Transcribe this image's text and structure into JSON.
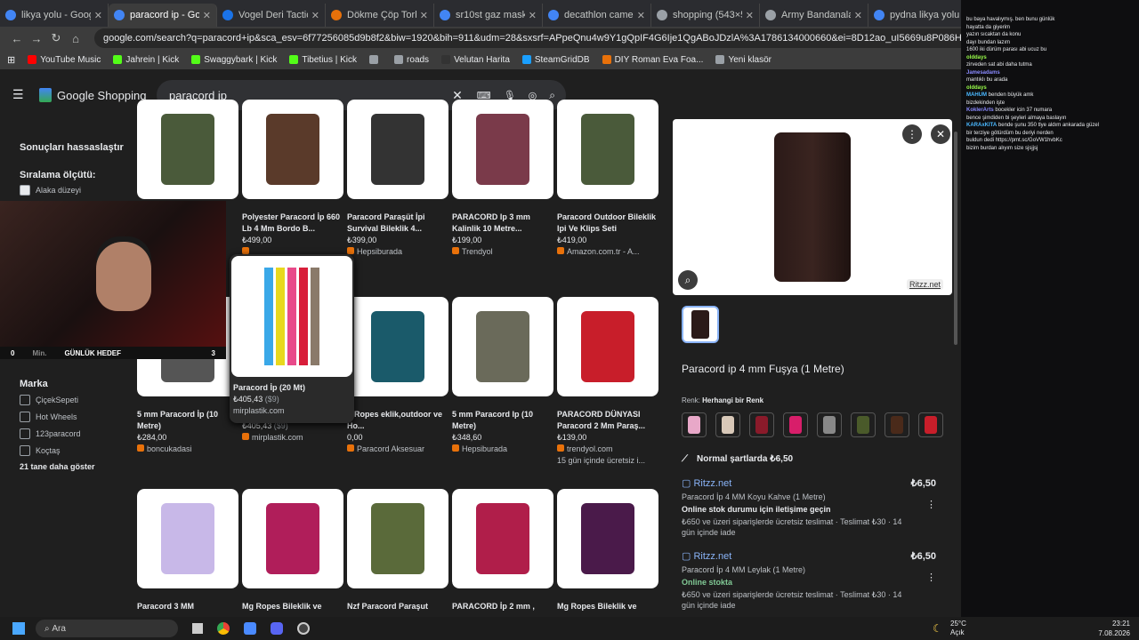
{
  "tabs": [
    {
      "label": "likya yolu - Google'da Ar",
      "color": "#4285f4",
      "active": false
    },
    {
      "label": "paracord ip - Google",
      "color": "#4285f4",
      "active": true
    },
    {
      "label": "Vogel Deri Tactical Bo",
      "color": "#1a73e8",
      "active": false
    },
    {
      "label": "Dökme Çöp Torbası D",
      "color": "#e8710a",
      "active": false
    },
    {
      "label": "sr10st gaz maskesi - G",
      "color": "#4285f4",
      "active": false
    },
    {
      "label": "decathlon camelbak",
      "color": "#4285f4",
      "active": false
    },
    {
      "label": "shopping (543×542)",
      "color": "#9aa0a6",
      "active": false
    },
    {
      "label": "Army Bandanalar « T",
      "color": "#9aa0a6",
      "active": false
    },
    {
      "label": "pydna likya yolu - Go",
      "color": "#4285f4",
      "active": false
    }
  ],
  "address": {
    "url": "google.com/search?q=paracord+ip&sca_esv=6f77256085d9b8f2&biw=1920&bih=911&udm=28&sxsrf=APpeQnu4w9Y1gQpIF4G6Ije1QgABoJDzlA%3A1786134000660&ei=8D12ao_uI5669u8P086HoAQ&oq=para..."
  },
  "bookmarks": [
    {
      "label": "YouTube Music",
      "color": "#ff0000"
    },
    {
      "label": "Jahrein | Kick",
      "color": "#53fc18"
    },
    {
      "label": "Swaggybark | Kick",
      "color": "#53fc18"
    },
    {
      "label": "Tibetius | Kick",
      "color": "#53fc18"
    },
    {
      "label": "",
      "color": "#9aa0a6"
    },
    {
      "label": "roads",
      "color": "#9aa0a6"
    },
    {
      "label": "Velutan Harita",
      "color": "#333"
    },
    {
      "label": "SteamGridDB",
      "color": "#1a9fff"
    },
    {
      "label": "DIY Roman Eva Foa...",
      "color": "#e8710a"
    },
    {
      "label": "Yeni klasör",
      "color": "#9aa0a6"
    }
  ],
  "header": {
    "logo": "Google Shopping",
    "query": "paracord ip"
  },
  "sidebar": {
    "refine": "Sonuçları hassaslaştır",
    "sort": "Sıralama ölçütü:",
    "relevance": "Alaka düzeyi",
    "brand": "Marka",
    "brands": [
      "ÇiçekSepeti",
      "Hot Wheels",
      "123paracord",
      "Koçtaş"
    ],
    "more": "21 tane daha göster"
  },
  "webcam": {
    "left": "0",
    "mid": "Min.",
    "title": "GÜNLÜK HEDEF",
    "right": "3"
  },
  "row1": [
    {
      "title": "",
      "price": "",
      "store": "",
      "color": "#4a5a3a"
    },
    {
      "title": "Polyester Paracord İp 660 Lb 4 Mm Bordo B...",
      "price": "₺499,00",
      "store": "",
      "color": "#5a3a2a"
    },
    {
      "title": "Paracord Paraşüt İpi Survival Bileklik 4...",
      "price": "₺399,00",
      "store": "Hepsiburada",
      "color": "#333"
    },
    {
      "title": "PARACORD Ip 3 mm Kalinlik 10 Metre...",
      "price": "₺199,00",
      "store": "Trendyol",
      "color": "#7a3a4a"
    },
    {
      "title": "Paracord Outdoor Bileklik Ipi Ve Klips Seti",
      "price": "₺419,00",
      "store": "Amazon.com.tr - A...",
      "color": "#4a5a3a"
    }
  ],
  "row2": [
    {
      "title": "5 mm Paracord İp (10 Metre)",
      "price": "₺284,00",
      "store": "boncukadasi",
      "color": "#555"
    },
    {
      "title": "Paracord İp (20 Mt)",
      "price": "₺405,43",
      "usd": "($9)",
      "store": "mirplastik.com",
      "color": "#e84a8a"
    },
    {
      "title": "g Ropes eklik,outdoor ve Ho...",
      "price": "0,00",
      "store": "Paracord Aksesuar",
      "color": "#1a5a6a"
    },
    {
      "title": "5 mm Paracord Ip (10 Metre)",
      "price": "₺348,60",
      "store": "Hepsiburada",
      "color": "#6a6a5a"
    },
    {
      "title": "PARACORD DÜNYASI Paracord 2 Mm Paraş...",
      "price": "₺139,00",
      "store": "trendyol.com",
      "note": "15 gün içinde ücretsiz i...",
      "color": "#c81e2a"
    }
  ],
  "row3": [
    {
      "title": "Paracord 3 MM",
      "color": "#c8b8e8"
    },
    {
      "title": "Mg Ropes Bileklik ve",
      "color": "#b01e5a"
    },
    {
      "title": "Nzf Paracord Paraşut",
      "color": "#5a6a3a"
    },
    {
      "title": "PARACORD İp 2 mm ,",
      "color": "#b01e4a"
    },
    {
      "title": "Mg Ropes Bileklik ve",
      "color": "#4a1a4a"
    }
  ],
  "detail": {
    "source": "Ritzz.net",
    "title": "Paracord ip 4 mm Fuşya (1 Metre)",
    "color_label": "Renk:",
    "color_value": "Herhangi bir Renk",
    "swatches": [
      "#e8a8c8",
      "#d8c8b8",
      "#8a1a2a",
      "#d81e6a",
      "#888",
      "#4a5a2a",
      "#4a2a1a",
      "#c81e2a"
    ],
    "normal_label": "Normal şartlarda ₺6,50",
    "offers": [
      {
        "store": "Ritzz.net",
        "price": "₺6,50",
        "desc": "Paracord İp 4 MM Koyu Kahve (1 Metre)",
        "stock": "Online stok durumu için iletişime geçin",
        "ship": "₺650 ve üzeri siparişlerde ücretsiz teslimat · Teslimat ₺30 · 14 gün içinde iade",
        "green": false
      },
      {
        "store": "Ritzz.net",
        "price": "₺6,50",
        "desc": "Paracord İp 4 MM Leylak (1 Metre)",
        "stock": "Online stokta",
        "ship": "₺650 ve üzeri siparişlerde ücretsiz teslimat · Teslimat ₺30 · 14 gün içinde iade",
        "green": true
      }
    ]
  },
  "chat": [
    {
      "u": "",
      "m": "bu baya havalıymış. ben bunu günlük",
      "c": "#ff4040"
    },
    {
      "u": "",
      "m": "hayatta da giyerim",
      "c": "#ff4040"
    },
    {
      "u": "",
      "m": "yazın sıcaktan da konu",
      "c": "#ff4040"
    },
    {
      "u": "",
      "m": "dayı bundan lazım",
      "c": "#ff4040"
    },
    {
      "u": "",
      "m": "1600 iki dürüm parası abi ucuz bu",
      "c": "#ff4040"
    },
    {
      "u": "olddays",
      "m": "",
      "c": "#9aff4a"
    },
    {
      "u": "",
      "m": "zirveden sat abi daha tutma",
      "c": "#ff4040"
    },
    {
      "u": "Jamesadams",
      "m": "",
      "c": "#8a8aff"
    },
    {
      "u": "",
      "m": "",
      "c": "#ff4040"
    },
    {
      "u": "",
      "m": "mantıklı bu arada",
      "c": "#ff4040"
    },
    {
      "u": "olddays",
      "m": "",
      "c": "#9aff4a"
    },
    {
      "u": "MAHUM",
      "m": "benden büyük amk",
      "c": "#4ab8ff"
    },
    {
      "u": "",
      "m": "bizdekinden işte",
      "c": "#ff4040"
    },
    {
      "u": "KoklerArts",
      "m": "bocekler icin 37 numara",
      "c": "#8a8aff"
    },
    {
      "u": "",
      "m": "bence şimdiden bi şeyleri almaya baslayın",
      "c": "#ff4040"
    },
    {
      "u": "KARAxKITA",
      "m": "bende şunu 350 tlye aldım ankarada güzel",
      "c": "#4ab8ff"
    },
    {
      "u": "",
      "m": "bir terziye götürdüm bu deriyi nerden",
      "c": "#ff4040"
    },
    {
      "u": "",
      "m": "buldun dedi https://pmt.sc/GoVW1hvbKc",
      "c": "#ff4040"
    },
    {
      "u": "",
      "m": "bizim burdan alıyım size sjsjjsj",
      "c": "#ff4040"
    }
  ],
  "taskbar": {
    "search": "Ara",
    "temp": "25°C",
    "weather": "Açık",
    "time": "23:21",
    "date": "7.08.2026"
  }
}
